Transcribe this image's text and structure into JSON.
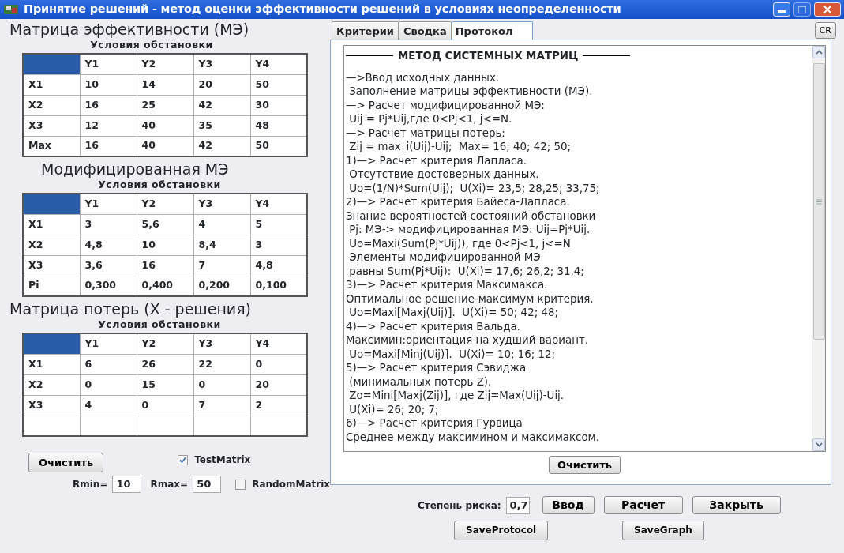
{
  "window": {
    "title": "Принятие решений - метод оценки эффективности решений в условиях неопределенности"
  },
  "matrices": [
    {
      "title": "Матрица эффективности (МЭ)",
      "subtitle": "Условия обстановки",
      "columns": [
        "Y1",
        "Y2",
        "Y3",
        "Y4"
      ],
      "rows": [
        {
          "label": "X1",
          "cells": [
            "10",
            "14",
            "20",
            "50"
          ]
        },
        {
          "label": "X2",
          "cells": [
            "16",
            "25",
            "42",
            "30"
          ]
        },
        {
          "label": "X3",
          "cells": [
            "12",
            "40",
            "35",
            "48"
          ]
        },
        {
          "label": "Max",
          "cells": [
            "16",
            "40",
            "42",
            "50"
          ]
        }
      ]
    },
    {
      "title": "Модифицированная МЭ",
      "subtitle": "Условия обстановки",
      "columns": [
        "Y1",
        "Y2",
        "Y3",
        "Y4"
      ],
      "rows": [
        {
          "label": "X1",
          "cells": [
            "3",
            "5,6",
            "4",
            "5"
          ]
        },
        {
          "label": "X2",
          "cells": [
            "4,8",
            "10",
            "8,4",
            "3"
          ]
        },
        {
          "label": "X3",
          "cells": [
            "3,6",
            "16",
            "7",
            "4,8"
          ]
        },
        {
          "label": "Pi",
          "cells": [
            "0,300",
            "0,400",
            "0,200",
            "0,100"
          ]
        }
      ]
    },
    {
      "title": "Матрица потерь (X - решения)",
      "subtitle": "Условия обстановки",
      "columns": [
        "Y1",
        "Y2",
        "Y3",
        "Y4"
      ],
      "rows": [
        {
          "label": "X1",
          "cells": [
            "6",
            "26",
            "22",
            "0"
          ]
        },
        {
          "label": "X2",
          "cells": [
            "0",
            "15",
            "0",
            "20"
          ]
        },
        {
          "label": "X3",
          "cells": [
            "4",
            "0",
            "7",
            "2"
          ]
        },
        {
          "label": "",
          "cells": [
            "",
            "",
            "",
            ""
          ]
        }
      ]
    }
  ],
  "left_controls": {
    "clear_button": "Очистить",
    "test_matrix": {
      "label": "TestMatrix",
      "checked": true
    },
    "rmin": {
      "label": "Rmin=",
      "value": "10"
    },
    "rmax": {
      "label": "Rmax=",
      "value": "50"
    },
    "random_matrix": {
      "label": "RandomMatrix",
      "checked": false
    }
  },
  "tabs": [
    {
      "label": "Критерии",
      "selected": false
    },
    {
      "label": "Сводка",
      "selected": false
    },
    {
      "label": "Протокол",
      "selected": true
    }
  ],
  "cr_button": "CR",
  "protocol": {
    "heading": "МЕТОД СИСТЕМНЫХ МАТРИЦ",
    "lines": [
      "—>Ввод исходных данных.",
      " Заполнение матрицы эффективности (МЭ).",
      "—> Расчет модифицированной МЭ:",
      " Uij = Pj*Uij,где 0<Pj<1, j<=N.",
      "—> Расчет матрицы потерь:",
      " Zij = max_i(Uij)-Uij;  Max= 16; 40; 42; 50;",
      "1)—> Расчет критерия Лапласа.",
      " Отсутствие достоверных данных.",
      " Uo=(1/N)*Sum(Uij);  U(Xi)= 23,5; 28,25; 33,75;",
      "2)—> Расчет критерия Байеса-Лапласа.",
      "Знание вероятностей состояний обстановки",
      " Pj: МЭ-> модифицированная МЭ: Uij=Pj*Uij.",
      " Uo=Maxi(Sum(Pj*Uij)), где 0<Pj<1, j<=N",
      " Элементы модифицированной МЭ",
      " равны Sum(Pj*Uij):  U(Xi)= 17,6; 26,2; 31,4;",
      "3)—> Расчет критерия Максимакса.",
      "Оптимальное решение-максимум критерия.",
      " Uo=Maxi[Maxj(Uij)].  U(Xi)= 50; 42; 48;",
      "4)—> Расчет критерия Вальда.",
      "Максимин:ориентация на худший вариант.",
      " Uo=Maxi[Minj(Uij)].  U(Xi)= 10; 16; 12;",
      "5)—> Расчет критерия Сэвиджа",
      " (минимальных потерь Z).",
      " Zo=Mini[Maxj(Zij)], где Zij=Max(Uij)-Uij.",
      " U(Xi)= 26; 20; 7;",
      "6)—> Расчет критерия Гурвица",
      "Среднее между максимином и максимаксом."
    ],
    "clear_button": "Очистить"
  },
  "bottom": {
    "risk": {
      "label": "Степень риска:",
      "value": "0,7"
    },
    "buttons": [
      "Ввод",
      "Расчет",
      "Закрыть"
    ],
    "save_buttons": [
      "SaveProtocol",
      "SaveGraph"
    ]
  }
}
